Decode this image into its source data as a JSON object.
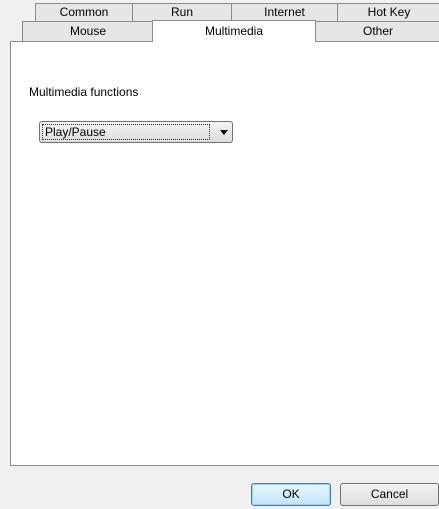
{
  "tabs_row1": [
    {
      "label": "Common"
    },
    {
      "label": "Run"
    },
    {
      "label": "Internet"
    },
    {
      "label": "Hot Key"
    }
  ],
  "tabs_row2": [
    {
      "label": "Mouse"
    },
    {
      "label": "Multimedia",
      "selected": true
    },
    {
      "label": "Other"
    }
  ],
  "panel": {
    "multimedia_label": "Multimedia functions",
    "function_select": {
      "value": "Play/Pause"
    }
  },
  "buttons": {
    "ok": "OK",
    "cancel": "Cancel"
  }
}
